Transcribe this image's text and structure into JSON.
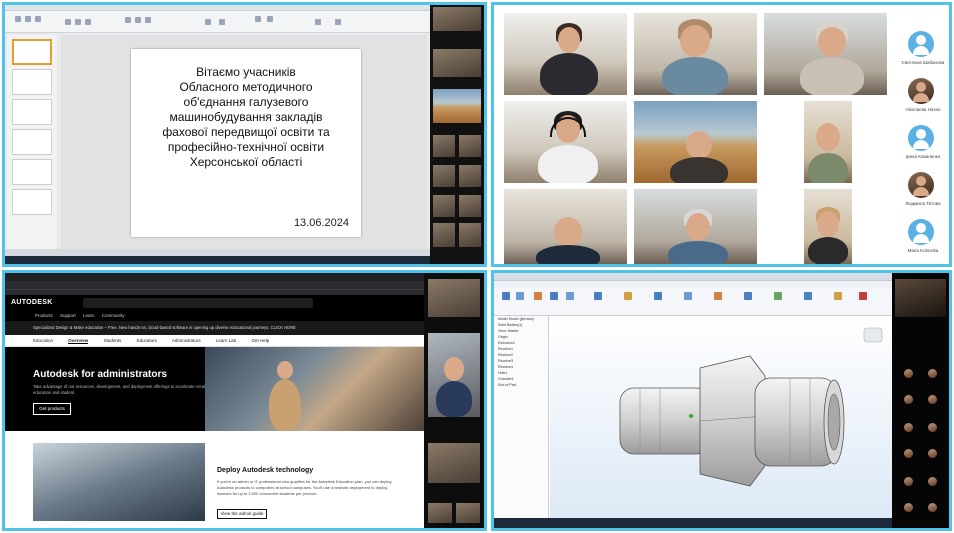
{
  "slide": {
    "title": "Вітаємо учасників\nОбласного методичного\nоб'єднання галузевого\nмашинобудування закладів\nфахової передвищої освіти та\nпрофесійно-технічної освіти\nХерсонської області",
    "date": "13.06.2024"
  },
  "gallery": {
    "avatars": [
      {
        "name": "Светлана Шабанова",
        "photo": false
      },
      {
        "name": "Ніколаєва Натал",
        "photo": true
      },
      {
        "name": "Ірина Коваленко",
        "photo": false
      },
      {
        "name": "Людмила Титова",
        "photo": true
      },
      {
        "name": "Maria Kolovska",
        "photo": false
      }
    ]
  },
  "autodesk": {
    "logo": "AUTODESK",
    "nav": "Products  Support  Learn  Community",
    "banner": "Specialized Design & Make education – Free. New hands-on, cloud-based software is opening up diverse educational journeys.  CLICK HERE",
    "tabs": [
      "Education",
      "Overview",
      "Students",
      "Educators",
      "Administrators",
      "Learn Lab",
      "Get Help"
    ],
    "hero_title": "Autodesk for administrators",
    "hero_text": "Take advantage of our resources, development, and deployment offerings to accelerate creative education and student.",
    "hero_button": "Get products",
    "section_title": "Deploy Autodesk technology",
    "section_text": "If you're an admin or IT professional who qualifies for the Autodesk Education plan, you can deploy Autodesk products to computers at school campuses. You'll use a network deployment to deploy licenses for up to 3,000 concurrent students per product.",
    "section_button": "View the admin guide"
  },
  "inventor": {
    "browser_items": [
      "Model Model (Деталь)",
      "Solid Bodies(1)",
      "View: Master",
      "Origin",
      "Extrusion1",
      "Revolve1",
      "Revolve2",
      "Revolve3",
      "Revolve4",
      "Hole1",
      "Chamfer1",
      "End of Part"
    ]
  }
}
